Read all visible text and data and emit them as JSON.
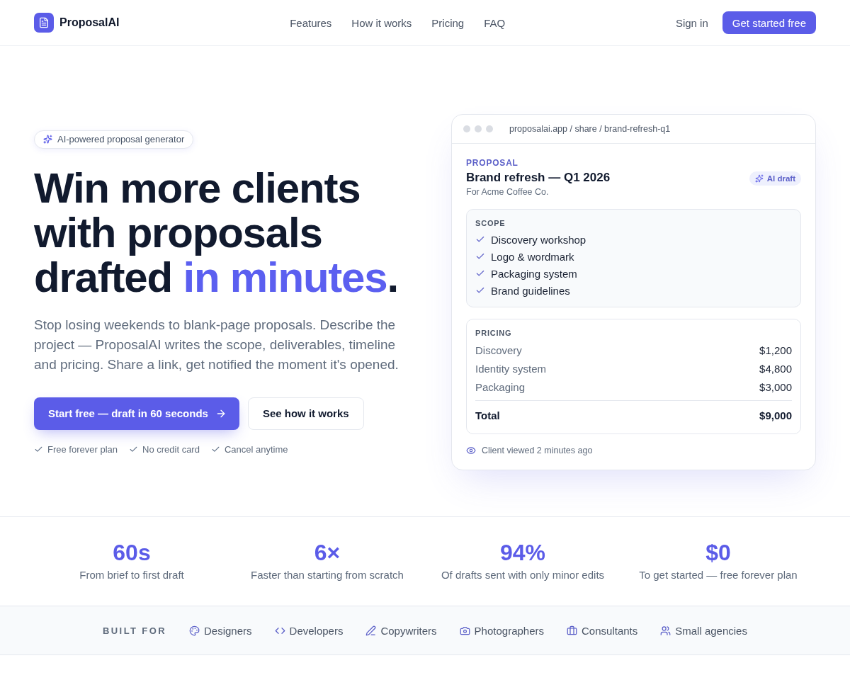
{
  "header": {
    "brand": "ProposalAI",
    "nav": [
      {
        "label": "Features"
      },
      {
        "label": "How it works"
      },
      {
        "label": "Pricing"
      },
      {
        "label": "FAQ"
      }
    ],
    "sign_in": "Sign in",
    "cta": "Get started free"
  },
  "hero": {
    "badge": "AI-powered proposal generator",
    "headline": [
      {
        "text": "Win more clients with proposals drafted ",
        "accent": false
      },
      {
        "text": "in minutes",
        "accent": true
      },
      {
        "text": ".",
        "accent": false
      }
    ],
    "description": "Stop losing weekends to blank-page proposals. Describe the project — ProposalAI writes the scope, deliverables, timeline and pricing. Share a link, get notified the moment it's opened.",
    "primary_button": "Start free — draft in 60 seconds",
    "secondary_button": "See how it works",
    "perks": [
      "Free forever plan",
      "No credit card",
      "Cancel anytime"
    ]
  },
  "preview": {
    "url": "proposalai.app / share / brand-refresh-q1",
    "eyebrow": "PROPOSAL",
    "title": "Brand refresh — Q1 2026",
    "client": "For Acme Coffee Co.",
    "tag": "AI draft",
    "scope": {
      "heading": "SCOPE",
      "items": [
        "Discovery workshop",
        "Logo & wordmark",
        "Packaging system",
        "Brand guidelines"
      ]
    },
    "pricing": {
      "heading": "PRICING",
      "rows": [
        {
          "item": "Discovery",
          "amount": "$1,200"
        },
        {
          "item": "Identity system",
          "amount": "$4,800"
        },
        {
          "item": "Packaging",
          "amount": "$3,000"
        }
      ],
      "total": {
        "label": "Total",
        "amount": "$9,000"
      }
    },
    "activity": "Client viewed 2 minutes ago"
  },
  "stats": [
    {
      "value": "60s",
      "label": "From brief to first draft"
    },
    {
      "value": "6×",
      "label": "Faster than starting from scratch"
    },
    {
      "value": "94%",
      "label": "Of drafts sent with only minor edits"
    },
    {
      "value": "$0",
      "label": "To get started — free forever plan"
    }
  ],
  "built_for": {
    "label": "BUILT FOR",
    "items": [
      {
        "label": "Designers"
      },
      {
        "label": "Developers"
      },
      {
        "label": "Copywriters"
      },
      {
        "label": "Photographers"
      },
      {
        "label": "Consultants"
      },
      {
        "label": "Small agencies"
      }
    ]
  }
}
